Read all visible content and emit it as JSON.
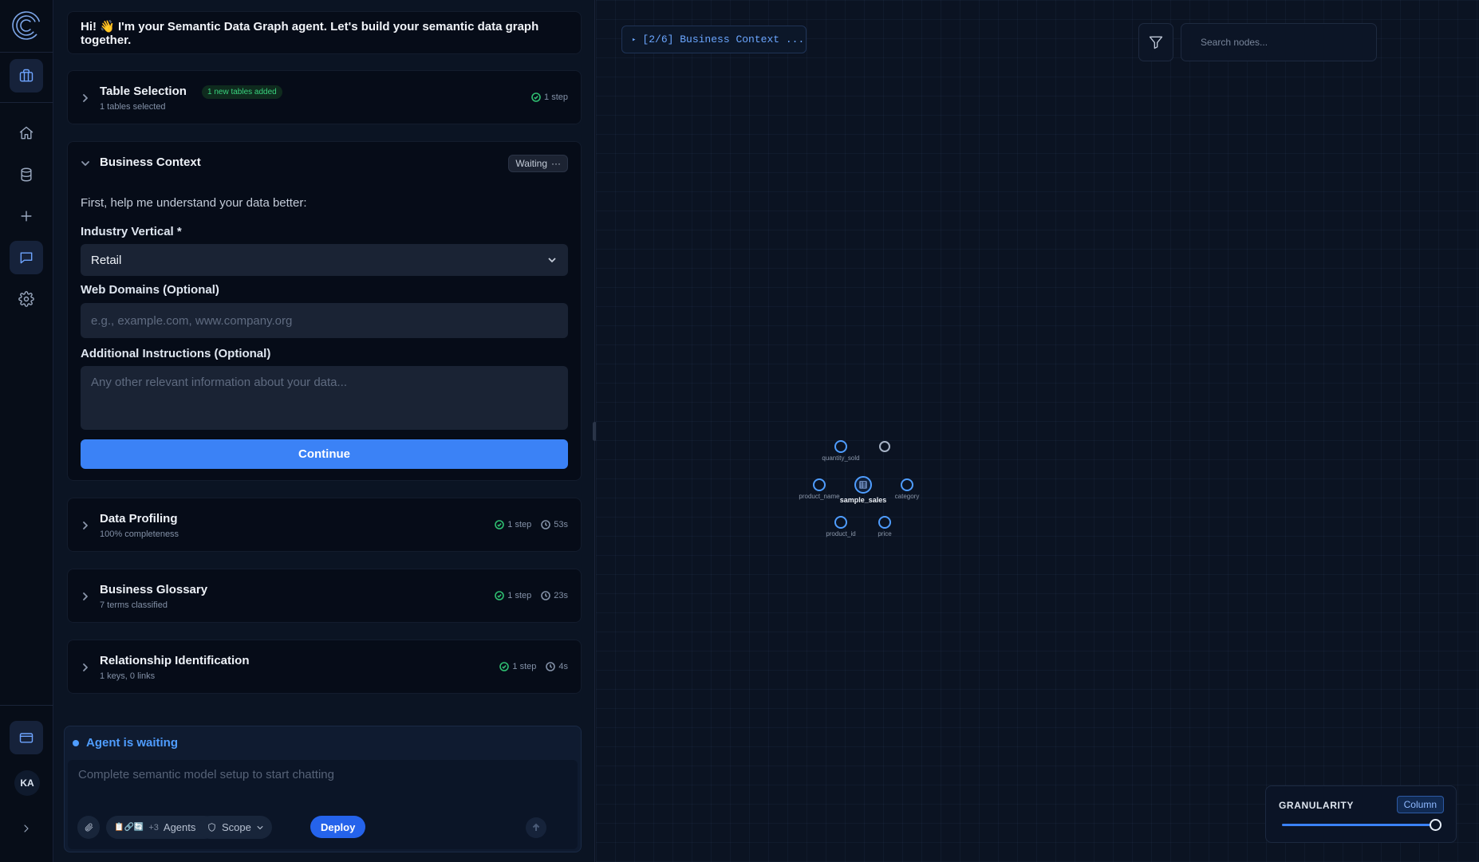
{
  "rail": {
    "avatar_initials": "KA"
  },
  "greeting": {
    "text": "Hi! 👋 I'm your Semantic Data Graph agent. Let's build your semantic data graph together."
  },
  "steps": {
    "table_selection": {
      "title": "Table Selection",
      "badge": "1 new tables added",
      "subtitle": "1 tables selected",
      "steps": "1 step"
    },
    "business_context": {
      "title": "Business Context",
      "status": "Waiting",
      "status_icon": "···",
      "intro": "First, help me understand your data better:",
      "industry_label": "Industry Vertical *",
      "industry_value": "Retail",
      "domains_label": "Web Domains (Optional)",
      "domains_placeholder": "e.g., example.com, www.company.org",
      "instructions_label": "Additional Instructions (Optional)",
      "instructions_placeholder": "Any other relevant information about your data...",
      "continue_label": "Continue"
    },
    "data_profiling": {
      "title": "Data Profiling",
      "subtitle": "100% completeness",
      "steps": "1 step",
      "time": "53s"
    },
    "business_glossary": {
      "title": "Business Glossary",
      "subtitle": "7 terms classified",
      "steps": "1 step",
      "time": "23s"
    },
    "relationship_identification": {
      "title": "Relationship Identification",
      "subtitle": "1 keys, 0 links",
      "steps": "1 step",
      "time": "4s"
    }
  },
  "composer": {
    "status": "Agent is waiting",
    "placeholder": "Complete semantic model setup to start chatting",
    "agent_icons": "📋🔗🔄",
    "agent_extra": "+3",
    "agents_label": "Agents",
    "scope_label": "Scope",
    "deploy_label": "Deploy"
  },
  "canvas": {
    "breadcrumb": "[2/6] Business Context ...",
    "search_placeholder": "Search nodes...",
    "graph": {
      "center": "sample_sales",
      "nodes": [
        "quantity_sold",
        "product_name",
        "category",
        "product_id",
        "price"
      ]
    },
    "granularity": {
      "title": "GRANULARITY",
      "value": "Column",
      "level": 1.0
    }
  },
  "colors": {
    "accent": "#3b82f6",
    "success": "#2fbf71",
    "node": "#4f9dff"
  }
}
